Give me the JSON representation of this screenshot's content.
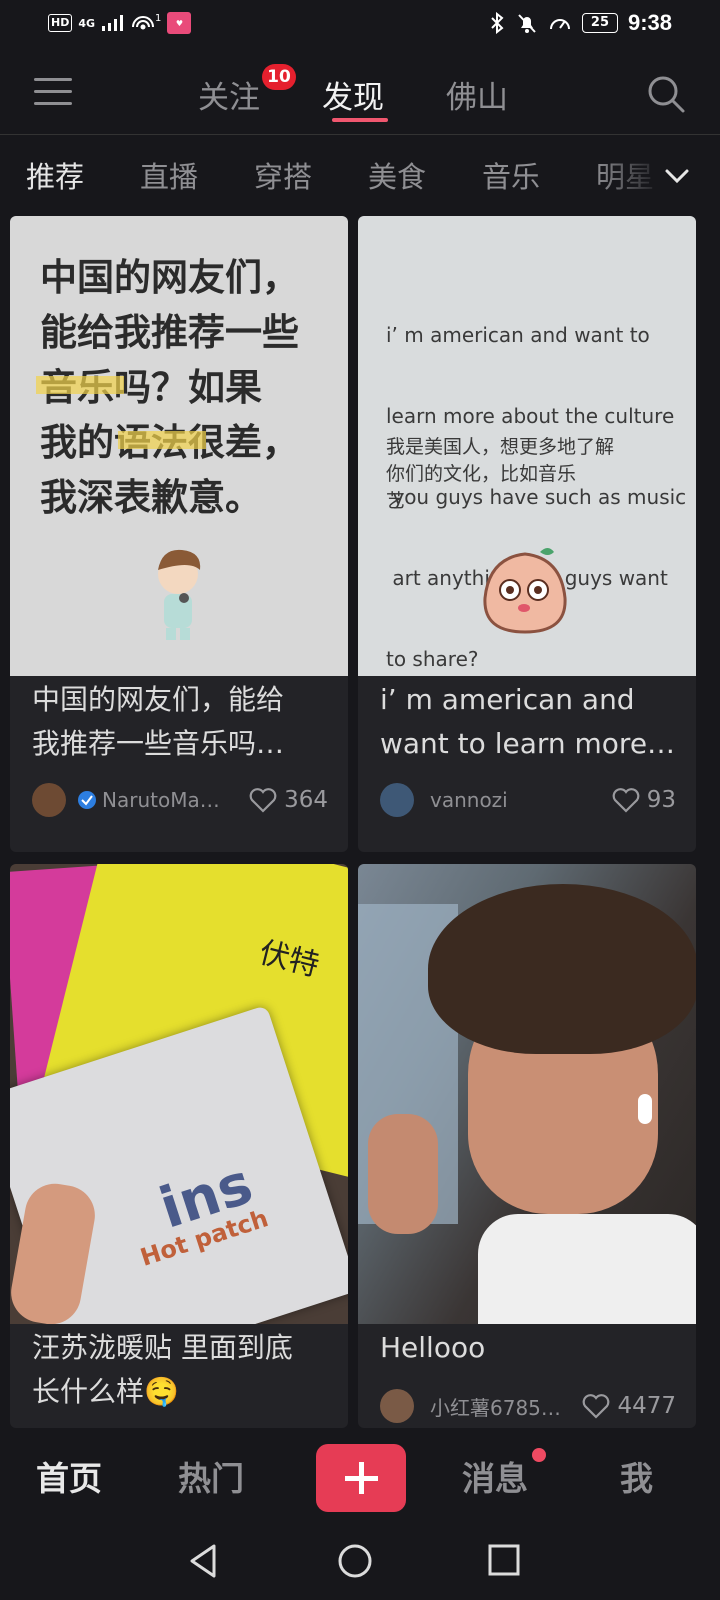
{
  "status_bar": {
    "hd": "HD",
    "network": "4G",
    "hotspot_count": "1",
    "battery": "25",
    "time": "9:38"
  },
  "top_nav": {
    "tabs": [
      {
        "label": "关注",
        "badge": "10"
      },
      {
        "label": "发现",
        "active": true
      },
      {
        "label": "佛山"
      }
    ],
    "accent_color": "#f0576f"
  },
  "categories": [
    "推荐",
    "直播",
    "穿搭",
    "美食",
    "音乐",
    "明星"
  ],
  "feed": [
    {
      "cover_lines": [
        "中国的网友们，",
        "能给我推荐一些",
        "音乐吗？如果",
        "我的语法很差，",
        "我深表歉意。"
      ],
      "title_lines": [
        "中国的网友们，能给",
        "我推荐一些音乐吗…"
      ],
      "author": "NarutoMa…",
      "likes": "364"
    },
    {
      "cover_en": [
        "i’ m american and want to",
        "learn more about the culture",
        " you guys have such as music",
        " art anything you guys want",
        "to share?"
      ],
      "cover_zh": [
        "我是美国人，想更多地了解",
        "你们的文化，比如音乐",
        "艺"
      ],
      "title_lines": [
        "i’ m american and",
        "want to learn more…"
      ],
      "author": "vannozi",
      "likes": "93"
    },
    {
      "cover_brand": "ins",
      "cover_sub": "Hot patch",
      "cover_book": "伏特",
      "title_lines": [
        "汪苏泷暖贴 里面到底",
        "长什么样🤤"
      ]
    },
    {
      "title_lines": [
        "Hellooo"
      ],
      "author": "小红薯6785…",
      "likes": "4477"
    }
  ],
  "bottom_nav": {
    "items": [
      "首页",
      "热门",
      "消息",
      "我"
    ],
    "plus": "+",
    "plus_color": "#e63c55"
  }
}
